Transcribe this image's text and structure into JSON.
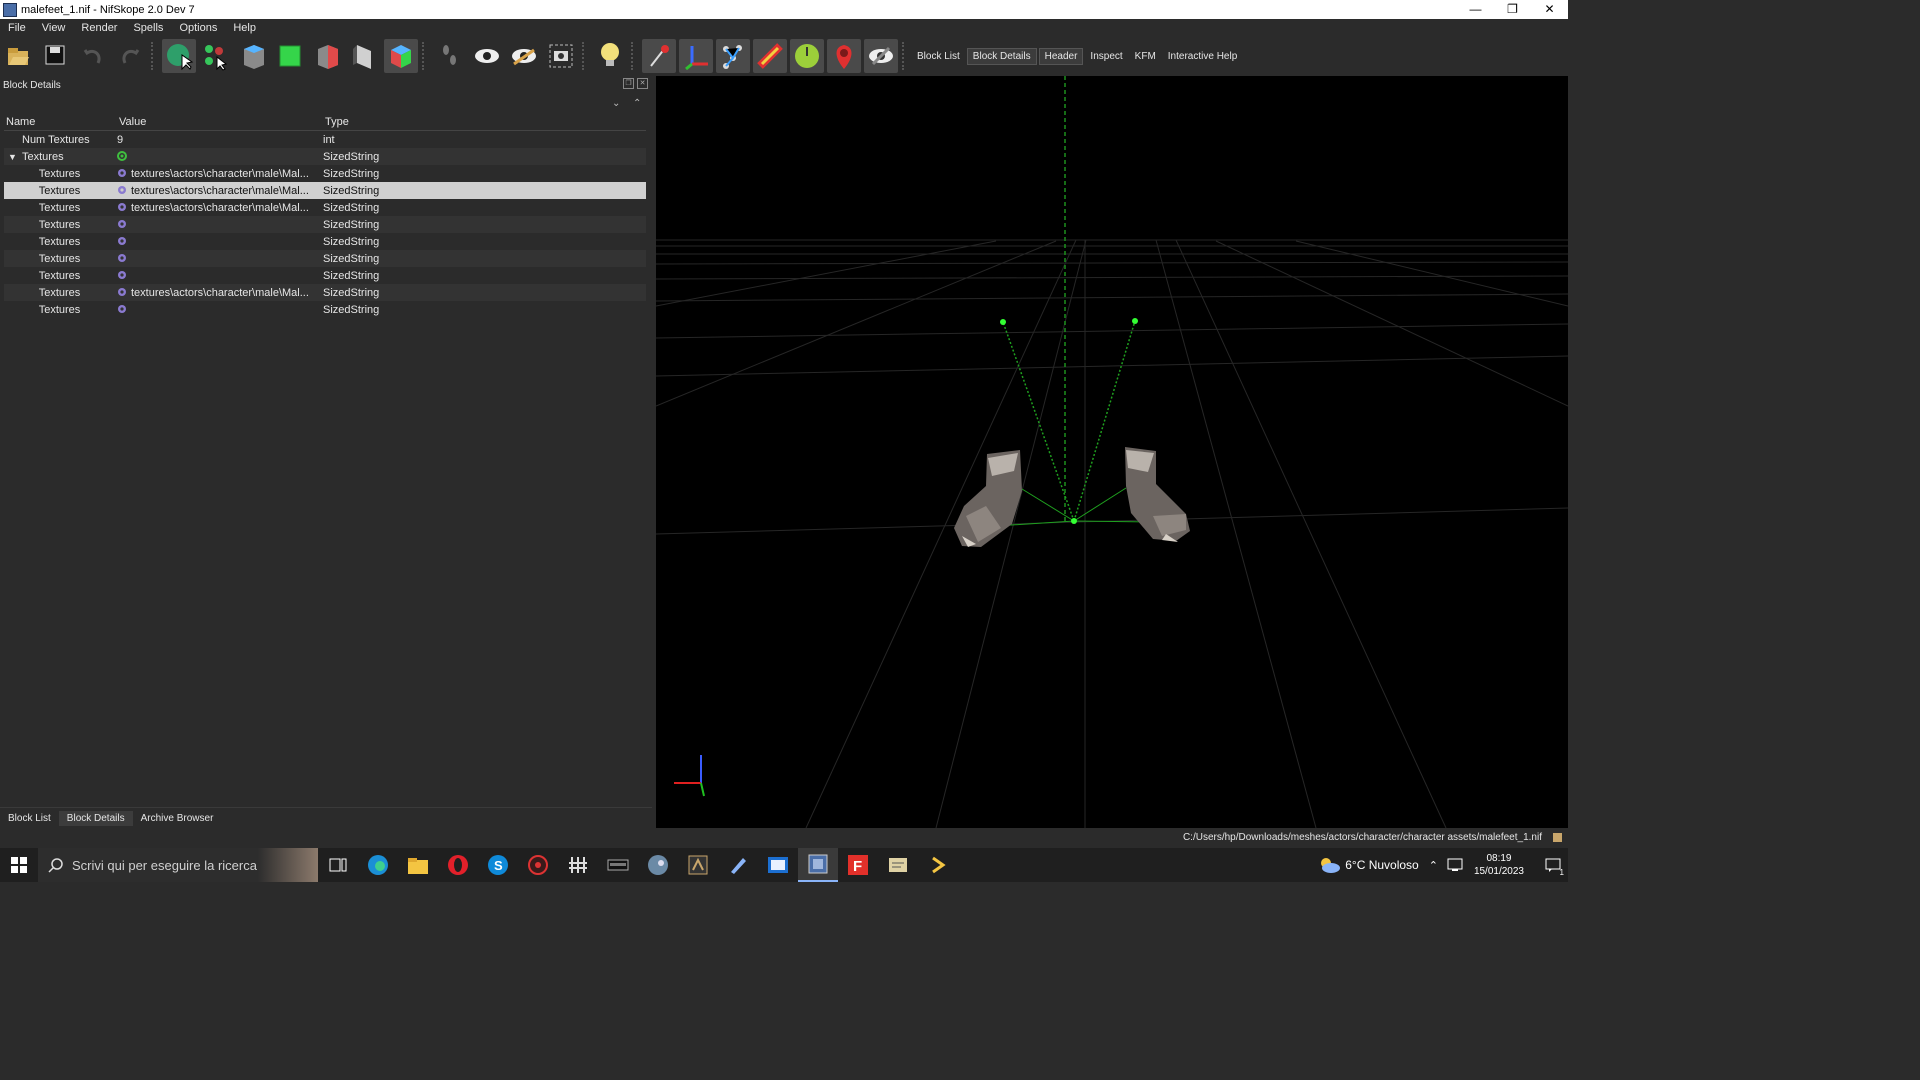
{
  "window": {
    "title": "malefeet_1.nif - NifSkope 2.0 Dev 7"
  },
  "menu": [
    "File",
    "View",
    "Render",
    "Spells",
    "Options",
    "Help"
  ],
  "toolbar_links": [
    "Block List",
    "Block Details",
    "Header",
    "Inspect",
    "KFM",
    "Interactive Help"
  ],
  "panel": {
    "title": "Block Details"
  },
  "tree": {
    "headers": {
      "name": "Name",
      "value": "Value",
      "type": "Type"
    },
    "rows": [
      {
        "name": "Num Textures",
        "value": "9",
        "type": "int"
      },
      {
        "name": "Textures",
        "value": "",
        "type": "SizedString"
      },
      {
        "name": "Textures",
        "value": "textures\\actors\\character\\male\\Mal...",
        "type": "SizedString"
      },
      {
        "name": "Textures",
        "value": "textures\\actors\\character\\male\\Mal...",
        "type": "SizedString"
      },
      {
        "name": "Textures",
        "value": "textures\\actors\\character\\male\\Mal...",
        "type": "SizedString"
      },
      {
        "name": "Textures",
        "value": "",
        "type": "SizedString"
      },
      {
        "name": "Textures",
        "value": "",
        "type": "SizedString"
      },
      {
        "name": "Textures",
        "value": "",
        "type": "SizedString"
      },
      {
        "name": "Textures",
        "value": "",
        "type": "SizedString"
      },
      {
        "name": "Textures",
        "value": "textures\\actors\\character\\male\\Mal...",
        "type": "SizedString"
      },
      {
        "name": "Textures",
        "value": "",
        "type": "SizedString"
      }
    ]
  },
  "bottom_tabs": [
    "Block List",
    "Block Details",
    "Archive Browser"
  ],
  "status": {
    "path": "C:/Users/hp/Downloads/meshes/actors/character/character assets/malefeet_1.nif"
  },
  "taskbar": {
    "search_placeholder": "Scrivi qui per eseguire la ricerca",
    "weather": "6°C  Nuvoloso",
    "time": "08:19",
    "date": "15/01/2023",
    "notification_count": "1"
  },
  "colors": {
    "accent": "#8ab4f8",
    "viewport": "#000000",
    "grid": "#2a2a2a",
    "skeleton": "#22cc22"
  }
}
